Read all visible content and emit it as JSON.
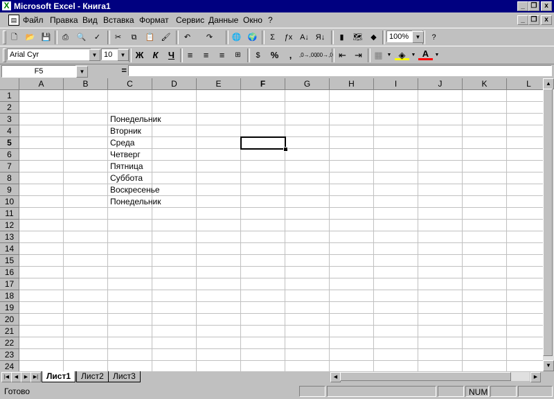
{
  "window": {
    "title": "Microsoft Excel - Книга1",
    "icon": "excel-icon",
    "controls": [
      "_",
      "❐",
      "x"
    ]
  },
  "menu": {
    "items": [
      "Файл",
      "Правка",
      "Вид",
      "Вставка",
      "Формат",
      "Сервис",
      "Данные",
      "Окно",
      "?"
    ]
  },
  "standard_toolbar": {
    "buttons": [
      "new-icon",
      "open-icon",
      "save-icon",
      "print-icon",
      "print-preview-icon",
      "spelling-icon",
      "cut-icon",
      "copy-icon",
      "paste-icon",
      "format-painter-icon",
      "undo-icon",
      "redo-icon",
      "hyperlink-icon",
      "web-toolbar-icon",
      "autosum-icon",
      "function-icon",
      "sort-ascending-icon",
      "sort-descending-icon",
      "chart-wizard-icon",
      "map-icon",
      "drawing-icon",
      "help-icon"
    ],
    "zoom": "100%"
  },
  "format_toolbar": {
    "font": "Arial Cyr",
    "size": "10",
    "bold": "Ж",
    "italic": "К",
    "underline": "Ч",
    "percent": "%",
    "comma": ",",
    "currency": "$",
    "increase_decimal": ",0→,00",
    "decrease_decimal": ",00→,0"
  },
  "formula_bar": {
    "name_box": "F5",
    "equals": "=",
    "value": ""
  },
  "sheet": {
    "columns": [
      "A",
      "B",
      "C",
      "D",
      "E",
      "F",
      "G",
      "H",
      "I",
      "J",
      "K",
      "L"
    ],
    "rows": [
      "1",
      "2",
      "3",
      "4",
      "5",
      "6",
      "7",
      "8",
      "9",
      "10",
      "11",
      "12",
      "13",
      "14",
      "15",
      "16",
      "17",
      "18",
      "19",
      "20",
      "21",
      "22",
      "23",
      "24"
    ],
    "active_cell": "F5",
    "cells": [
      {
        "ref": "C3",
        "value": "Понедельник"
      },
      {
        "ref": "C4",
        "value": "Вторник"
      },
      {
        "ref": "C5",
        "value": "Среда"
      },
      {
        "ref": "C6",
        "value": "Четверг"
      },
      {
        "ref": "C7",
        "value": "Пятница"
      },
      {
        "ref": "C8",
        "value": "Суббота"
      },
      {
        "ref": "C9",
        "value": "Воскресенье"
      },
      {
        "ref": "C10",
        "value": "Понедельник"
      }
    ]
  },
  "sheet_tabs": [
    "Лист1",
    "Лист2",
    "Лист3"
  ],
  "active_tab": "Лист1",
  "status": {
    "ready": "Готово",
    "num": "NUM"
  }
}
